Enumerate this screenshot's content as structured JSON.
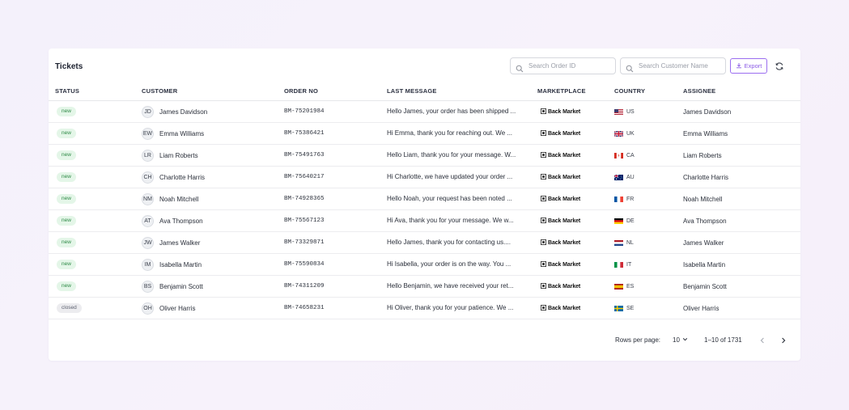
{
  "header": {
    "title": "Tickets",
    "search_order_placeholder": "Search Order ID",
    "search_customer_placeholder": "Search Customer Name",
    "export_label": "Export"
  },
  "columns": {
    "status": "STATUS",
    "customer": "CUSTOMER",
    "order_no": "ORDER NO",
    "last_message": "LAST MESSAGE",
    "marketplace": "MARKETPLACE",
    "country": "COUNTRY",
    "assignee": "ASSIGNEE"
  },
  "tickets": [
    {
      "status": "new",
      "initials": "JD",
      "customer": "James Davidson",
      "order_no": "BM-75201984",
      "last_message": "Hello James, your order has been shipped ...",
      "marketplace": "Back Market",
      "country_code": "US",
      "flag": "us",
      "assignee": "James Davidson"
    },
    {
      "status": "new",
      "initials": "EW",
      "customer": "Emma Williams",
      "order_no": "BM-75386421",
      "last_message": "Hi Emma, thank you for reaching out. We ...",
      "marketplace": "Back Market",
      "country_code": "UK",
      "flag": "uk",
      "assignee": "Emma Williams"
    },
    {
      "status": "new",
      "initials": "LR",
      "customer": "Liam Roberts",
      "order_no": "BM-75491763",
      "last_message": "Hello Liam, thank you for your message. W...",
      "marketplace": "Back Market",
      "country_code": "CA",
      "flag": "ca",
      "assignee": "Liam Roberts"
    },
    {
      "status": "new",
      "initials": "CH",
      "customer": "Charlotte Harris",
      "order_no": "BM-75640217",
      "last_message": "Hi Charlotte, we have updated your order ...",
      "marketplace": "Back Market",
      "country_code": "AU",
      "flag": "au",
      "assignee": "Charlotte Harris"
    },
    {
      "status": "new",
      "initials": "NM",
      "customer": "Noah Mitchell",
      "order_no": "BM-74928365",
      "last_message": "Hello Noah, your request has been noted ...",
      "marketplace": "Back Market",
      "country_code": "FR",
      "flag": "fr",
      "assignee": "Noah Mitchell"
    },
    {
      "status": "new",
      "initials": "AT",
      "customer": "Ava Thompson",
      "order_no": "BM-75567123",
      "last_message": "Hi Ava, thank you for your message. We w...",
      "marketplace": "Back Market",
      "country_code": "DE",
      "flag": "de",
      "assignee": "Ava Thompson"
    },
    {
      "status": "new",
      "initials": "JW",
      "customer": "James Walker",
      "order_no": "BM-73329871",
      "last_message": "Hello James, thank you for contacting us....",
      "marketplace": "Back Market",
      "country_code": "NL",
      "flag": "nl",
      "assignee": "James Walker"
    },
    {
      "status": "new",
      "initials": "IM",
      "customer": "Isabella Martin",
      "order_no": "BM-75590834",
      "last_message": "Hi Isabella, your order is on the way. You ...",
      "marketplace": "Back Market",
      "country_code": "IT",
      "flag": "it",
      "assignee": "Isabella Martin"
    },
    {
      "status": "new",
      "initials": "BS",
      "customer": "Benjamin Scott",
      "order_no": "BM-74311209",
      "last_message": "Hello Benjamin, we have received your ret...",
      "marketplace": "Back Market",
      "country_code": "ES",
      "flag": "es",
      "assignee": "Benjamin Scott"
    },
    {
      "status": "closed",
      "initials": "OH",
      "customer": "Oliver Harris",
      "order_no": "BM-74658231",
      "last_message": "Hi Oliver, thank you for your patience. We ...",
      "marketplace": "Back Market",
      "country_code": "SE",
      "flag": "se",
      "assignee": "Oliver Harris"
    }
  ],
  "pagination": {
    "rows_per_page_label": "Rows per page:",
    "rows_per_page_value": "10",
    "range_label": "1–10 of 1731"
  },
  "colors": {
    "accent": "#8a5ae6",
    "new_badge_bg": "#e4f6e8",
    "new_badge_text": "#2e8a46",
    "closed_badge_bg": "#ececef"
  }
}
